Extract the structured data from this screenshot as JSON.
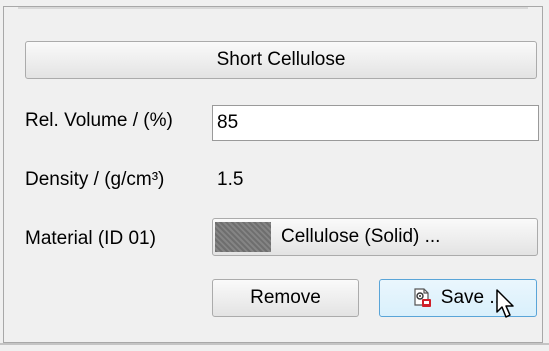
{
  "section": {
    "header_button_label": "Short Cellulose"
  },
  "fields": {
    "rel_volume_label": "Rel. Volume / (%)",
    "rel_volume_value": "85",
    "density_label": "Density / (g/cm³)",
    "density_value": "1.5",
    "material_label": "Material (ID 01)",
    "material_button_label": "Cellulose (Solid) ..."
  },
  "actions": {
    "remove_label": "Remove",
    "save_label": "Save ..."
  },
  "colors": {
    "material_swatch": "#777777",
    "save_accent": "#5aa5d8",
    "save_icon_red": "#d0202a"
  },
  "icons": {
    "save_button_icon": "save-settings-icon",
    "cursor": "mouse-pointer-icon"
  }
}
